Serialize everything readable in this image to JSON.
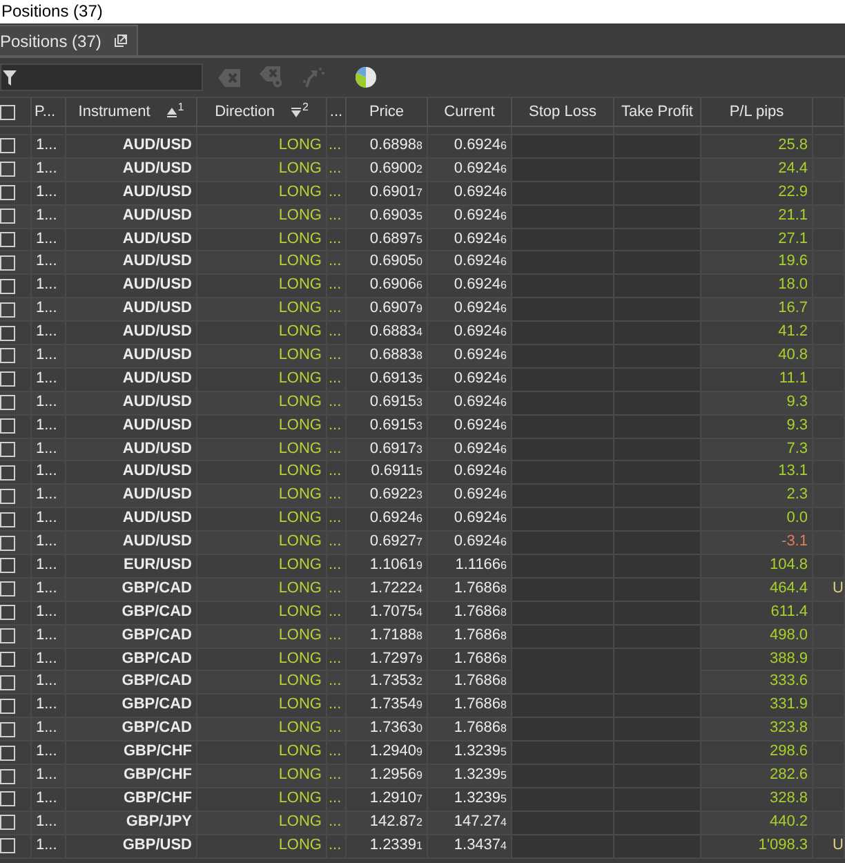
{
  "window": {
    "title": "Positions (37)"
  },
  "tabs": [
    {
      "label": "Positions (37)",
      "selected": true
    }
  ],
  "toolbar": [
    {
      "kind": "clear",
      "disabled": true
    },
    {
      "kind": "clear_settings",
      "disabled": true
    },
    {
      "kind": "arrow",
      "disabled": true
    },
    {
      "kind": "chart",
      "disabled": false
    }
  ],
  "table": {
    "select_all_checked": false,
    "columns": [
      {
        "label": "P..."
      },
      {
        "label": "Instrument",
        "sort_ascending": true,
        "sort_order": "1"
      },
      {
        "label": "Direction",
        "sort_ascending": false,
        "sort_order": "2"
      },
      {
        "label": "..."
      },
      {
        "label": "Price"
      },
      {
        "label": "Current"
      },
      {
        "label": "Stop Loss"
      },
      {
        "label": "Take Profit"
      },
      {
        "label": "P/L pips"
      }
    ],
    "rows": [
      {
        "checked": false,
        "column_2": "1...",
        "instrument": "AUD/USD",
        "direction": "LONG",
        "column_5": "...",
        "price": "0.6898$_{8}$",
        "current": "0.6924$_{6}$",
        "pl_pips": "25.8",
        "negative": false
      },
      {
        "checked": false,
        "column_2": "1...",
        "instrument": "AUD/USD",
        "direction": "LONG",
        "column_5": "...",
        "price": "0.6900$_{2}$",
        "current": "0.6924$_{6}$",
        "pl_pips": "24.4",
        "negative": false
      },
      {
        "checked": false,
        "column_2": "1...",
        "instrument": "AUD/USD",
        "direction": "LONG",
        "column_5": "...",
        "price": "0.6901$_{7}$",
        "current": "0.6924$_{6}$",
        "pl_pips": "22.9",
        "negative": false
      },
      {
        "checked": false,
        "column_2": "1...",
        "instrument": "AUD/USD",
        "direction": "LONG",
        "column_5": "...",
        "price": "0.6903$_{5}$",
        "current": "0.6924$_{6}$",
        "pl_pips": "21.1",
        "negative": false
      },
      {
        "checked": false,
        "column_2": "1...",
        "instrument": "AUD/USD",
        "direction": "LONG",
        "column_5": "...",
        "price": "0.6897$_{5}$",
        "current": "0.6924$_{6}$",
        "pl_pips": "27.1",
        "negative": false
      },
      {
        "checked": false,
        "column_2": "1...",
        "instrument": "AUD/USD",
        "direction": "LONG",
        "column_5": "...",
        "price": "0.6905$_{0}$",
        "current": "0.6924$_{6}$",
        "pl_pips": "19.6",
        "negative": false
      },
      {
        "checked": false,
        "column_2": "1...",
        "instrument": "AUD/USD",
        "direction": "LONG",
        "column_5": "...",
        "price": "0.6906$_{6}$",
        "current": "0.6924$_{6}$",
        "pl_pips": "18.0",
        "negative": false
      },
      {
        "checked": false,
        "column_2": "1...",
        "instrument": "AUD/USD",
        "direction": "LONG",
        "column_5": "...",
        "price": "0.6907$_{9}$",
        "current": "0.6924$_{6}$",
        "pl_pips": "16.7",
        "negative": false
      },
      {
        "checked": false,
        "column_2": "1...",
        "instrument": "AUD/USD",
        "direction": "LONG",
        "column_5": "...",
        "price": "0.6883$_{4}$",
        "current": "0.6924$_{6}$",
        "pl_pips": "41.2",
        "negative": false
      },
      {
        "checked": false,
        "column_2": "1...",
        "instrument": "AUD/USD",
        "direction": "LONG",
        "column_5": "...",
        "price": "0.6883$_{8}$",
        "current": "0.6924$_{6}$",
        "pl_pips": "40.8",
        "negative": false
      },
      {
        "checked": false,
        "column_2": "1...",
        "instrument": "AUD/USD",
        "direction": "LONG",
        "column_5": "...",
        "price": "0.6913$_{5}$",
        "current": "0.6924$_{6}$",
        "pl_pips": "11.1",
        "negative": false
      },
      {
        "checked": false,
        "column_2": "1...",
        "instrument": "AUD/USD",
        "direction": "LONG",
        "column_5": "...",
        "price": "0.6915$_{3}$",
        "current": "0.6924$_{6}$",
        "pl_pips": "9.3",
        "negative": false
      },
      {
        "checked": false,
        "column_2": "1...",
        "instrument": "AUD/USD",
        "direction": "LONG",
        "column_5": "...",
        "price": "0.6915$_{3}$",
        "current": "0.6924$_{6}$",
        "pl_pips": "9.3",
        "negative": false
      },
      {
        "checked": false,
        "column_2": "1...",
        "instrument": "AUD/USD",
        "direction": "LONG",
        "column_5": "...",
        "price": "0.6917$_{3}$",
        "current": "0.6924$_{6}$",
        "pl_pips": "7.3",
        "negative": false
      },
      {
        "checked": false,
        "column_2": "1...",
        "instrument": "AUD/USD",
        "direction": "LONG",
        "column_5": "...",
        "price": "0.6911$_{5}$",
        "current": "0.6924$_{6}$",
        "pl_pips": "13.1",
        "negative": false
      },
      {
        "checked": false,
        "column_2": "1...",
        "instrument": "AUD/USD",
        "direction": "LONG",
        "column_5": "...",
        "price": "0.6922$_{3}$",
        "current": "0.6924$_{6}$",
        "pl_pips": "2.3",
        "negative": false
      },
      {
        "checked": false,
        "column_2": "1...",
        "instrument": "AUD/USD",
        "direction": "LONG",
        "column_5": "...",
        "price": "0.6924$_{6}$",
        "current": "0.6924$_{6}$",
        "pl_pips": "0.0",
        "negative": false
      },
      {
        "checked": false,
        "column_2": "1...",
        "instrument": "AUD/USD",
        "direction": "LONG",
        "column_5": "...",
        "price": "0.6927$_{7}$",
        "current": "0.6924$_{6}$",
        "pl_pips": "-3.1",
        "negative": true
      },
      {
        "checked": false,
        "column_2": "1...",
        "instrument": "EUR/USD",
        "direction": "LONG",
        "column_5": "...",
        "price": "1.1061$_{9}$",
        "current": "1.1166$_{6}$",
        "pl_pips": "104.8",
        "negative": false
      },
      {
        "checked": false,
        "column_2": "1...",
        "instrument": "GBP/CAD",
        "direction": "LONG",
        "column_5": "...",
        "price": "1.7222$_{4}$",
        "current": "1.7686$_{8}$",
        "pl_pips": "464.4",
        "negative": false,
        "column_11": "U"
      },
      {
        "checked": false,
        "column_2": "1...",
        "instrument": "GBP/CAD",
        "direction": "LONG",
        "column_5": "...",
        "price": "1.7075$_{4}$",
        "current": "1.7686$_{8}$",
        "pl_pips": "611.4",
        "negative": false
      },
      {
        "checked": false,
        "column_2": "1...",
        "instrument": "GBP/CAD",
        "direction": "LONG",
        "column_5": "...",
        "price": "1.7188$_{8}$",
        "current": "1.7686$_{8}$",
        "pl_pips": "498.0",
        "negative": false
      },
      {
        "checked": false,
        "column_2": "1...",
        "instrument": "GBP/CAD",
        "direction": "LONG",
        "column_5": "...",
        "price": "1.7297$_{9}$",
        "current": "1.7686$_{8}$",
        "pl_pips": "388.9",
        "negative": false
      },
      {
        "checked": false,
        "column_2": "1...",
        "instrument": "GBP/CAD",
        "direction": "LONG",
        "column_5": "...",
        "price": "1.7353$_{2}$",
        "current": "1.7686$_{8}$",
        "pl_pips": "333.6",
        "negative": false
      },
      {
        "checked": false,
        "column_2": "1...",
        "instrument": "GBP/CAD",
        "direction": "LONG",
        "column_5": "...",
        "price": "1.7354$_{9}$",
        "current": "1.7686$_{8}$",
        "pl_pips": "331.9",
        "negative": false
      },
      {
        "checked": false,
        "column_2": "1...",
        "instrument": "GBP/CAD",
        "direction": "LONG",
        "column_5": "...",
        "price": "1.7363$_{0}$",
        "current": "1.7686$_{8}$",
        "pl_pips": "323.8",
        "negative": false
      },
      {
        "checked": false,
        "column_2": "1...",
        "instrument": "GBP/CHF",
        "direction": "LONG",
        "column_5": "...",
        "price": "1.2940$_{9}$",
        "current": "1.3239$_{5}$",
        "pl_pips": "298.6",
        "negative": false
      },
      {
        "checked": false,
        "column_2": "1...",
        "instrument": "GBP/CHF",
        "direction": "LONG",
        "column_5": "...",
        "price": "1.2956$_{9}$",
        "current": "1.3239$_{5}$",
        "pl_pips": "282.6",
        "negative": false
      },
      {
        "checked": false,
        "column_2": "1...",
        "instrument": "GBP/CHF",
        "direction": "LONG",
        "column_5": "...",
        "price": "1.2910$_{7}$",
        "current": "1.3239$_{5}$",
        "pl_pips": "328.8",
        "negative": false
      },
      {
        "checked": false,
        "column_2": "1...",
        "instrument": "GBP/JPY",
        "direction": "LONG",
        "column_5": "...",
        "price": "142.87$_{2}$",
        "current": "147.27$_{4}$",
        "pl_pips": "440.2",
        "negative": false
      },
      {
        "checked": false,
        "column_2": "1...",
        "instrument": "GBP/USD",
        "direction": "LONG",
        "column_5": "...",
        "price": "1.2339$_{1}$",
        "current": "1.3437$_{4}$",
        "pl_pips": "1'098.3",
        "negative": false,
        "column_11": "U"
      }
    ]
  }
}
